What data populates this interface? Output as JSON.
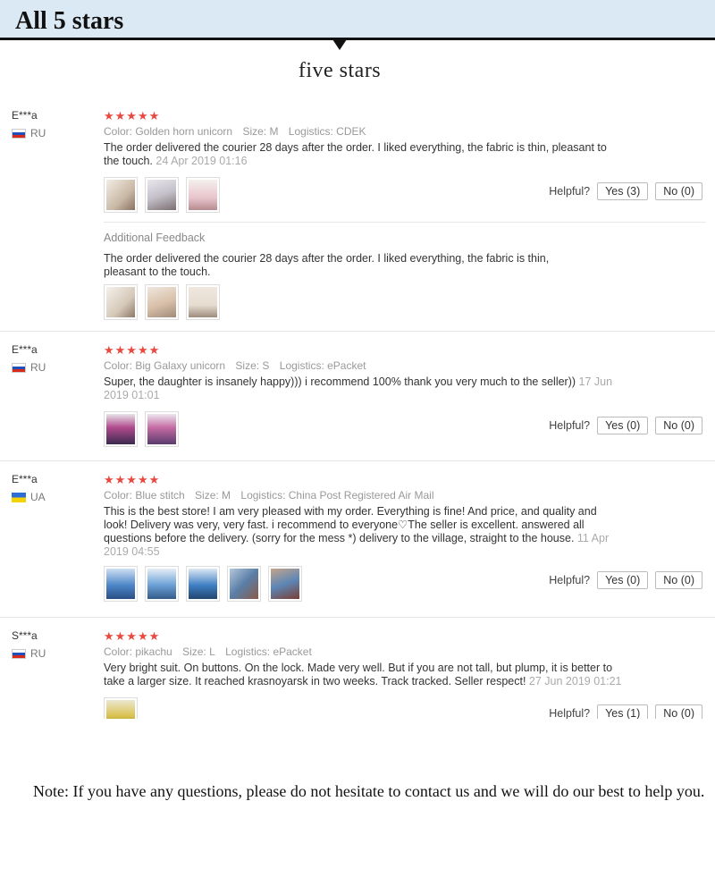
{
  "header": {
    "title": "All 5 stars",
    "subtitle": "five stars"
  },
  "reviews": [
    {
      "user": "E***a",
      "country": "RU",
      "stars": "★★★★★",
      "color": "Color: Golden horn unicorn",
      "size": "Size: M",
      "logistics": "Logistics: CDEK",
      "text_line1": "The order delivered the courier 28 days after the order. I liked everything, the fabric is thin, pleasant to",
      "text_line2": "the touch.",
      "date": "24 Apr 2019 01:16",
      "helpful_label": "Helpful?",
      "yes_label": "Yes (3)",
      "no_label": "No (0)",
      "additional_label": "Additional Feedback",
      "additional_line1": "The order delivered the courier 28 days after the order. I liked everything, the fabric is thin,",
      "additional_line2": "pleasant to the touch."
    },
    {
      "user": "E***a",
      "country": "RU",
      "stars": "★★★★★",
      "color": "Color: Big Galaxy unicorn",
      "size": "Size: S",
      "logistics": "Logistics: ePacket",
      "text_line1": "Super, the daughter is insanely happy))) i recommend 100% thank you very much to the seller))",
      "date1": "17 Jun",
      "date2": "2019 01:01",
      "helpful_label": "Helpful?",
      "yes_label": "Yes (0)",
      "no_label": "No (0)"
    },
    {
      "user": "E***a",
      "country": "UA",
      "stars": "★★★★★",
      "color": "Color: Blue stitch",
      "size": "Size: M",
      "logistics": "Logistics: China Post Registered Air Mail",
      "text_line1": "This is the best store! I am very pleased with my order. Everything is fine! And price, and quality and",
      "text_line2": "look! Delivery was very, very fast. i recommend to everyone♡The seller is excellent. answered all",
      "text_line3": "questions before the delivery. (sorry for the mess *) delivery to the village, straight to the house.",
      "date1": "11 Apr",
      "date2": "2019 04:55",
      "helpful_label": "Helpful?",
      "yes_label": "Yes (0)",
      "no_label": "No (0)"
    },
    {
      "user": "S***a",
      "country": "RU",
      "stars": "★★★★★",
      "color": "Color: pikachu",
      "size": "Size: L",
      "logistics": "Logistics: ePacket",
      "text_line1": "Very bright suit. On buttons. On the lock. Made very well. But if you are not tall, but plump, it is better to",
      "text_line2": "take a larger size. It reached krasnoyarsk in two weeks. Track tracked. Seller respect!",
      "date": "27 Jun 2019 01:21",
      "helpful_label": "Helpful?",
      "yes_label": "Yes (1)",
      "no_label": "No (0)"
    }
  ],
  "note": "Note: If you have any questions, please do not hesitate to contact us and we will do our best to help you.",
  "colors": {
    "banner_bg": "#dbe9f4",
    "stars": "#e8483f",
    "meta_text": "#999999"
  }
}
